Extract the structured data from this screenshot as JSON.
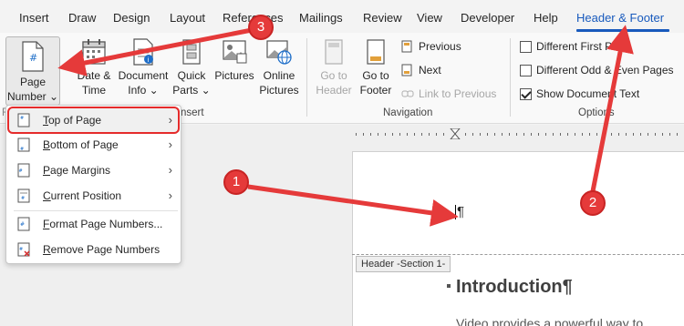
{
  "tabs": [
    {
      "label": "Insert"
    },
    {
      "label": "Draw"
    },
    {
      "label": "Design"
    },
    {
      "label": "Layout"
    },
    {
      "label": "References"
    },
    {
      "label": "Mailings"
    },
    {
      "label": "Review"
    },
    {
      "label": "View"
    },
    {
      "label": "Developer"
    },
    {
      "label": "Help"
    },
    {
      "label": "Header & Footer",
      "active": true
    }
  ],
  "ribbon": {
    "page_number": {
      "line1": "Page",
      "line2": "Number ⌄"
    },
    "date_time": {
      "line1": "Date &",
      "line2": "Time"
    },
    "document_info": {
      "line1": "Document",
      "line2": "Info ⌄"
    },
    "quick_parts": {
      "line1": "Quick",
      "line2": "Parts ⌄"
    },
    "pictures": {
      "line1": "Pictures"
    },
    "online_pictures": {
      "line1": "Online",
      "line2": "Pictures"
    },
    "insert_group": "nsert",
    "go_to_header": {
      "line1": "Go to",
      "line2": "Header"
    },
    "go_to_footer": {
      "line1": "Go to",
      "line2": "Footer"
    },
    "previous": "Previous",
    "next": "Next",
    "link_to_previous": "Link to Previous",
    "navigation_group": "Navigation",
    "different_first_page": "Different First Page",
    "different_odd_even": "Different Odd & Even Pages",
    "show_document_text": "Show Document Text",
    "options_group": "Options",
    "left_group_fragment": "F"
  },
  "menu": {
    "items": [
      {
        "label": "Top of Page",
        "underline": "T",
        "rest": "op of Page",
        "has_submenu": true
      },
      {
        "label": "Bottom of Page",
        "underline": "B",
        "rest": "ottom of Page",
        "has_submenu": true
      },
      {
        "label": "Page Margins",
        "underline": "P",
        "rest": "age Margins",
        "has_submenu": true
      },
      {
        "label": "Current Position",
        "underline": "C",
        "rest": "urrent Position",
        "has_submenu": true
      },
      {
        "label": "Format Page Numbers...",
        "underline": "F",
        "rest": "ormat Page Numbers...",
        "has_submenu": false
      },
      {
        "label": "Remove Page Numbers",
        "underline": "R",
        "rest": "emove Page Numbers",
        "has_submenu": false
      }
    ]
  },
  "document": {
    "pilcrow": "¶",
    "header_tag": "Header -Section 1-",
    "heading": "Introduction¶",
    "body_text": "Video provides a powerful way to"
  },
  "annotations": {
    "badge1": "1",
    "badge2": "2",
    "badge3": "3",
    "color": "#e53a3a"
  },
  "colors": {
    "accent": "#185abd",
    "highlight_box": "#e52b2b"
  }
}
